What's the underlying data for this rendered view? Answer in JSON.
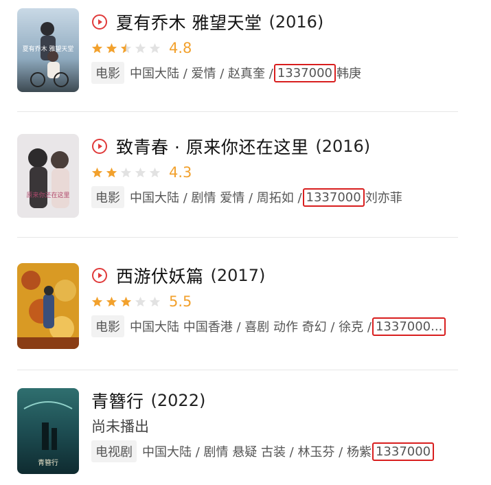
{
  "items": [
    {
      "title": "夏有乔木 雅望天堂",
      "year": "(2016)",
      "rating": 4.8,
      "stars_filled": 2.5,
      "score": "4.8",
      "tag": "电影",
      "meta_before": "中国大陆 / 爱情 / 赵真奎 /",
      "highlight": "1337000",
      "meta_after": "韩庚",
      "poster_text": "夏有乔木 雅望天堂",
      "icon": "play-circle-icon"
    },
    {
      "title": "致青春 · 原来你还在这里",
      "year": "(2016)",
      "rating": 4.3,
      "stars_filled": 2,
      "score": "4.3",
      "tag": "电影",
      "meta_before": "中国大陆 / 剧情 爱情 / 周拓如 /",
      "highlight": "1337000",
      "meta_after": "刘亦菲",
      "poster_text": "原来你还在这里",
      "icon": "play-circle-icon"
    },
    {
      "title": "西游伏妖篇",
      "year": "(2017)",
      "rating": 5.5,
      "stars_filled": 3,
      "score": "5.5",
      "tag": "电影",
      "meta_before": "中国大陆 中国香港 / 喜剧 动作 奇幻 / 徐克 /",
      "highlight": "1337000...",
      "meta_after": "",
      "poster_text": "",
      "icon": "play-circle-icon"
    },
    {
      "title": "青簪行",
      "year": "(2022)",
      "status": "尚未播出",
      "tag": "电视剧",
      "meta_before": "中国大陆 / 剧情 悬疑 古装 / 林玉芬 / 杨紫",
      "highlight": "1337000",
      "meta_after": "",
      "poster_text": "青簪行",
      "icon": ""
    }
  ],
  "colors": {
    "accent_red": "#e03a3a",
    "star_gold": "#f2a12d",
    "star_empty": "#e2e2e2",
    "highlight_border": "#d81e1e"
  }
}
